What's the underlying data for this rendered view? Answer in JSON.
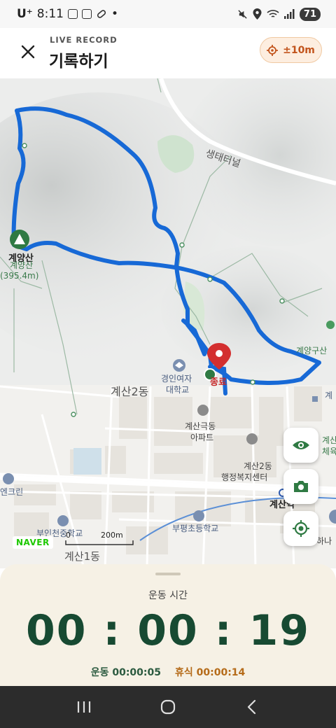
{
  "status_bar": {
    "carrier": "U⁺",
    "time": "8:11",
    "battery": "71",
    "dot": "•"
  },
  "header": {
    "subtitle": "LIVE RECORD",
    "title": "기록하기",
    "accuracy": "±10m",
    "accent_color": "#c2541c"
  },
  "map": {
    "route_color": "#1769d6",
    "labels": {
      "mountain_name": "계양산",
      "mountain_name_faint": "계양산",
      "mountain_height": "(395.4m)",
      "tunnel": "생태터널",
      "university_line1": "경인여자",
      "university_line2": "대학교",
      "end_marker": "종료",
      "district": "계산2동",
      "apartment_line1": "계산극동",
      "apartment_line2": "아파트",
      "welfare_line1": "계산2동",
      "welfare_line2": "행정복지센터",
      "station": "계산역",
      "school1": "부평초등학교",
      "school2": "부인천중학교",
      "district2": "계산1동",
      "enclean": "엔크린",
      "gyeyang_gu": "계양구산",
      "right_edge1": "계",
      "right_edge2": "계산",
      "right_edge3": "체육",
      "right_edge4": "하나",
      "scale_zero": "0",
      "scale_distance": "200m",
      "naver_logo": "NAVER"
    },
    "buttons": [
      "eye-icon",
      "camera-icon",
      "locate-icon"
    ]
  },
  "timer": {
    "label": "운동 시간",
    "elapsed": "00 : 00 : 19",
    "exercise_label": "운동",
    "exercise_time": "00:00:05",
    "rest_label": "휴식",
    "rest_time": "00:00:14",
    "primary_color": "#174a32"
  },
  "nav_bar": [
    "recent-apps-icon",
    "home-icon",
    "back-icon"
  ]
}
